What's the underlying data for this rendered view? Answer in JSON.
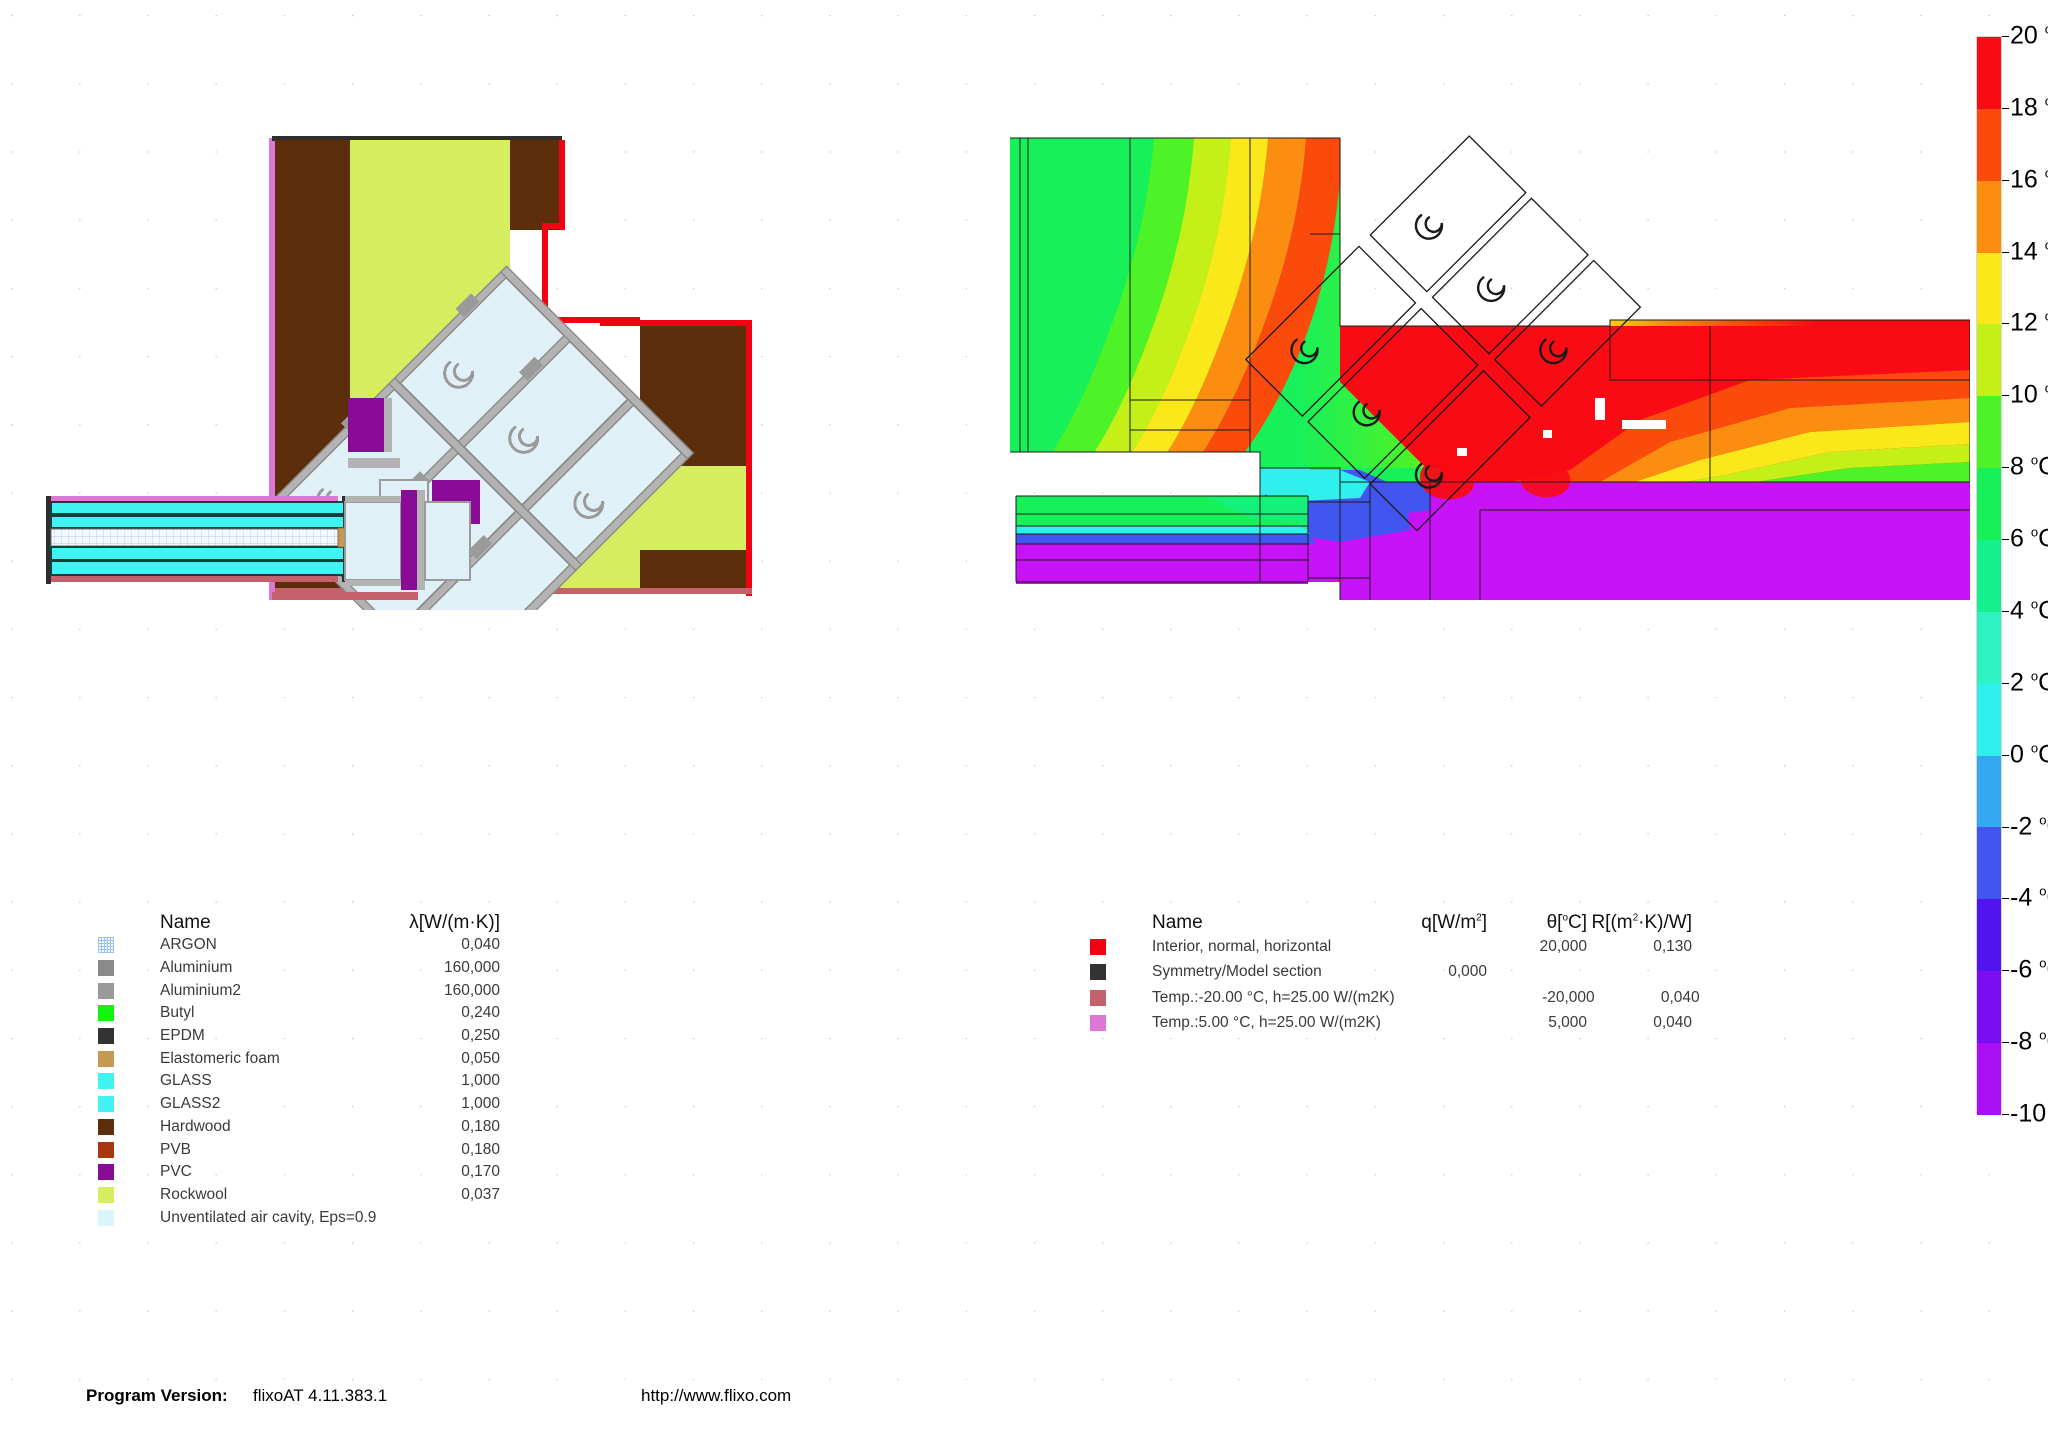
{
  "materials_table": {
    "headers": {
      "name": "Name",
      "lambda": "λ[W/(m·K)]"
    },
    "rows": [
      {
        "name": "ARGON",
        "lambda": "0,040",
        "color": "#dfeefc",
        "pattern": "grid"
      },
      {
        "name": "Aluminium",
        "lambda": "160,000",
        "color": "#8a8a8a",
        "pattern": "solid"
      },
      {
        "name": "Aluminium2",
        "lambda": "160,000",
        "color": "#9a9a9a",
        "pattern": "solid"
      },
      {
        "name": "Butyl",
        "lambda": "0,240",
        "color": "#12f312",
        "pattern": "solid"
      },
      {
        "name": "EPDM",
        "lambda": "0,250",
        "color": "#333333",
        "pattern": "solid"
      },
      {
        "name": "Elastomeric foam",
        "lambda": "0,050",
        "color": "#c49a53",
        "pattern": "solid"
      },
      {
        "name": "GLASS",
        "lambda": "1,000",
        "color": "#40f4f4",
        "pattern": "solid"
      },
      {
        "name": "GLASS2",
        "lambda": "1,000",
        "color": "#45f2f2",
        "pattern": "solid"
      },
      {
        "name": "Hardwood",
        "lambda": "0,180",
        "color": "#5d2e0c",
        "pattern": "solid"
      },
      {
        "name": "PVB",
        "lambda": "0,180",
        "color": "#a8360f",
        "pattern": "solid"
      },
      {
        "name": "PVC",
        "lambda": "0,170",
        "color": "#8a0b96",
        "pattern": "solid"
      },
      {
        "name": "Rockwool",
        "lambda": "0,037",
        "color": "#d6ed60",
        "pattern": "solid"
      },
      {
        "name": "Unventilated air cavity, Eps=0.9",
        "lambda": "",
        "color": "#d9f6fb",
        "pattern": "solid"
      }
    ]
  },
  "boundary_table": {
    "headers": {
      "name": "Name",
      "q": "q[W/m²]",
      "theta": "θ[°C]",
      "r": "R[(m²·K)/W]"
    },
    "rows": [
      {
        "name": "Interior, normal, horizontal",
        "q": "",
        "theta": "20,000",
        "r": "0,130",
        "color": "#f50012"
      },
      {
        "name": "Symmetry/Model section",
        "q": "0,000",
        "theta": "",
        "r": "",
        "color": "#333333"
      },
      {
        "name": "Temp.:-20.00 °C, h=25.00 W/(m2K)",
        "q": "",
        "theta": "-20,000",
        "r": "0,040",
        "color": "#c3626c"
      },
      {
        "name": "Temp.:5.00 °C, h=25.00 W/(m2K)",
        "q": "",
        "theta": "5,000",
        "r": "0,040",
        "color": "#dd77d6"
      }
    ]
  },
  "color_scale": {
    "unit": "C",
    "bands": [
      {
        "label": "20",
        "color": "#fa0a14"
      },
      {
        "label": "18",
        "color": "#fb4b0c"
      },
      {
        "label": "16",
        "color": "#fb8d10"
      },
      {
        "label": "14",
        "color": "#fbe81a"
      },
      {
        "label": "12",
        "color": "#c4f018"
      },
      {
        "label": "10",
        "color": "#4df227"
      },
      {
        "label": "8",
        "color": "#18f05a"
      },
      {
        "label": "6",
        "color": "#13f08c"
      },
      {
        "label": "4",
        "color": "#2ef2c4"
      },
      {
        "label": "2",
        "color": "#2ff0ec"
      },
      {
        "label": "0",
        "color": "#34a8f2"
      },
      {
        "label": "-2",
        "color": "#4056ee"
      },
      {
        "label": "-4",
        "color": "#5312f0"
      },
      {
        "label": "-6",
        "color": "#7a0df2"
      },
      {
        "label": "-8",
        "color": "#a80ff5"
      },
      {
        "label": "-10",
        "color": "#c812f7"
      }
    ]
  },
  "footer": {
    "program_version_label": "Program Version:",
    "program_version_value": "flixoAT 4.11.383.1",
    "url": "http://www.flixo.com"
  }
}
